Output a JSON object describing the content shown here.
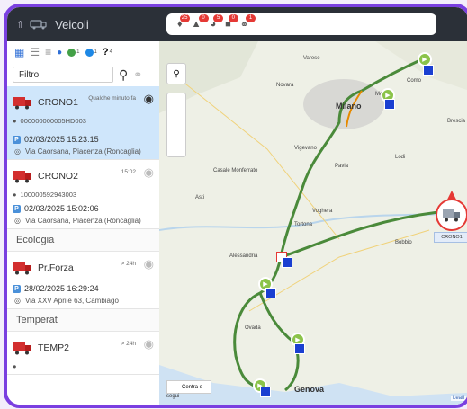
{
  "sidebar": {
    "title": "Veicoli",
    "filter_placeholder": "Filtro",
    "tool_counts": {
      "green": "1",
      "blue": "1",
      "question": "4"
    },
    "groups": [
      {
        "title": "",
        "cards": [
          {
            "name": "CRONO1",
            "meta": "Qualche minuto fa",
            "id": "000000000005HD003",
            "date": "02/03/2025 15:23:15",
            "address": "Via Caorsana, Piacenza (Roncaglia)",
            "selected": true,
            "visible": true
          },
          {
            "name": "CRONO2",
            "meta": "15:02",
            "id": "100000592943003",
            "date": "02/03/2025 15:02:06",
            "address": "Via Caorsana, Piacenza (Roncaglia)",
            "selected": false,
            "visible": false
          }
        ]
      },
      {
        "title": "Ecologia",
        "cards": [
          {
            "name": "Pr.Forza",
            "meta": "> 24h",
            "id": "",
            "date": "28/02/2025 16:29:24",
            "address": "Via XXV Aprile 63, Cambiago",
            "selected": false,
            "visible": false
          }
        ]
      },
      {
        "title": "Temperat",
        "cards": [
          {
            "name": "TEMP2",
            "meta": "> 24h",
            "id": "",
            "date": "",
            "address": "",
            "selected": false,
            "visible": false
          }
        ]
      }
    ]
  },
  "toolbar": {
    "badges": [
      "25",
      "0",
      "5",
      "0",
      "1"
    ]
  },
  "map": {
    "cities": [
      "Milano",
      "Genova",
      "Alessandria",
      "Novara",
      "Lodi",
      "Pavia",
      "Vigevano",
      "Voghera",
      "Asti",
      "Tortona",
      "Casale Monferrato",
      "Bobbio",
      "Ovada",
      "Varese",
      "Como",
      "Monza",
      "Brescia"
    ],
    "vehicle_label": "CRONO1",
    "bottom_control": "Centra e",
    "bottom_control_sub": "segui",
    "attribution": "Leafl"
  }
}
